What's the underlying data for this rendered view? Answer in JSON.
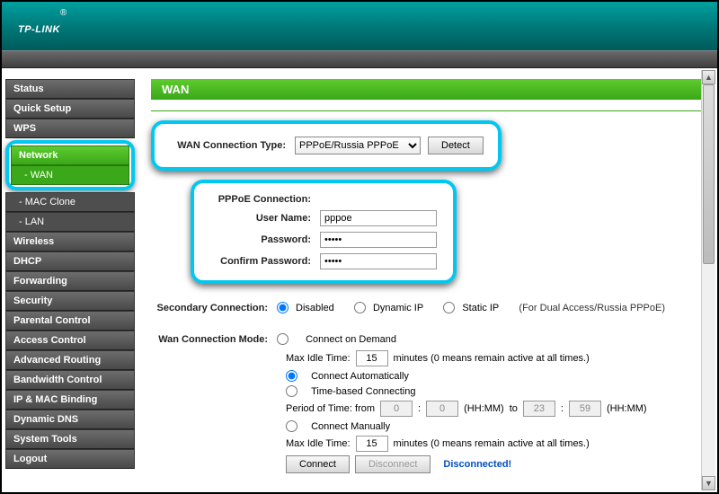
{
  "logo": "TP-LINK",
  "sidebar": {
    "items": [
      {
        "label": "Status",
        "active": false,
        "sub": false
      },
      {
        "label": "Quick Setup",
        "active": false,
        "sub": false
      },
      {
        "label": "WPS",
        "active": false,
        "sub": false
      },
      {
        "label": "Network",
        "active": true,
        "sub": false
      },
      {
        "label": "- WAN",
        "active": true,
        "sub": true
      },
      {
        "label": "- MAC Clone",
        "active": false,
        "sub": true
      },
      {
        "label": "- LAN",
        "active": false,
        "sub": true
      },
      {
        "label": "Wireless",
        "active": false,
        "sub": false
      },
      {
        "label": "DHCP",
        "active": false,
        "sub": false
      },
      {
        "label": "Forwarding",
        "active": false,
        "sub": false
      },
      {
        "label": "Security",
        "active": false,
        "sub": false
      },
      {
        "label": "Parental Control",
        "active": false,
        "sub": false
      },
      {
        "label": "Access Control",
        "active": false,
        "sub": false
      },
      {
        "label": "Advanced Routing",
        "active": false,
        "sub": false
      },
      {
        "label": "Bandwidth Control",
        "active": false,
        "sub": false
      },
      {
        "label": "IP & MAC Binding",
        "active": false,
        "sub": false
      },
      {
        "label": "Dynamic DNS",
        "active": false,
        "sub": false
      },
      {
        "label": "System Tools",
        "active": false,
        "sub": false
      },
      {
        "label": "Logout",
        "active": false,
        "sub": false
      }
    ]
  },
  "page": {
    "title": "WAN",
    "wan_type_label": "WAN Connection Type:",
    "wan_type_value": "PPPoE/Russia PPPoE",
    "detect_btn": "Detect",
    "pppoe_heading": "PPPoE Connection:",
    "user_label": "User Name:",
    "user_value": "pppoe",
    "pass_label": "Password:",
    "pass_value": "•••••",
    "pass2_label": "Confirm Password:",
    "pass2_value": "•••••",
    "secondary_label": "Secondary Connection:",
    "sec_opts": {
      "disabled": "Disabled",
      "dynamic": "Dynamic IP",
      "static": "Static IP"
    },
    "sec_note": "(For Dual Access/Russia PPPoE)",
    "mode_label": "Wan Connection Mode:",
    "mode": {
      "demand": "Connect on Demand",
      "idle_label": "Max Idle Time:",
      "idle_val": "15",
      "idle_note": "minutes (0 means remain active at all times.)",
      "auto": "Connect Automatically",
      "time": "Time-based Connecting",
      "period_label": "Period of Time: from",
      "p_h1": "0",
      "p_m1": "0",
      "p_h2": "23",
      "p_m2": "59",
      "hhmm": "(HH:MM)",
      "to": "to",
      "manual": "Connect Manually",
      "idle2_val": "15"
    },
    "connect_btn": "Connect",
    "disconnect_btn": "Disconnect",
    "status": "Disconnected!"
  }
}
